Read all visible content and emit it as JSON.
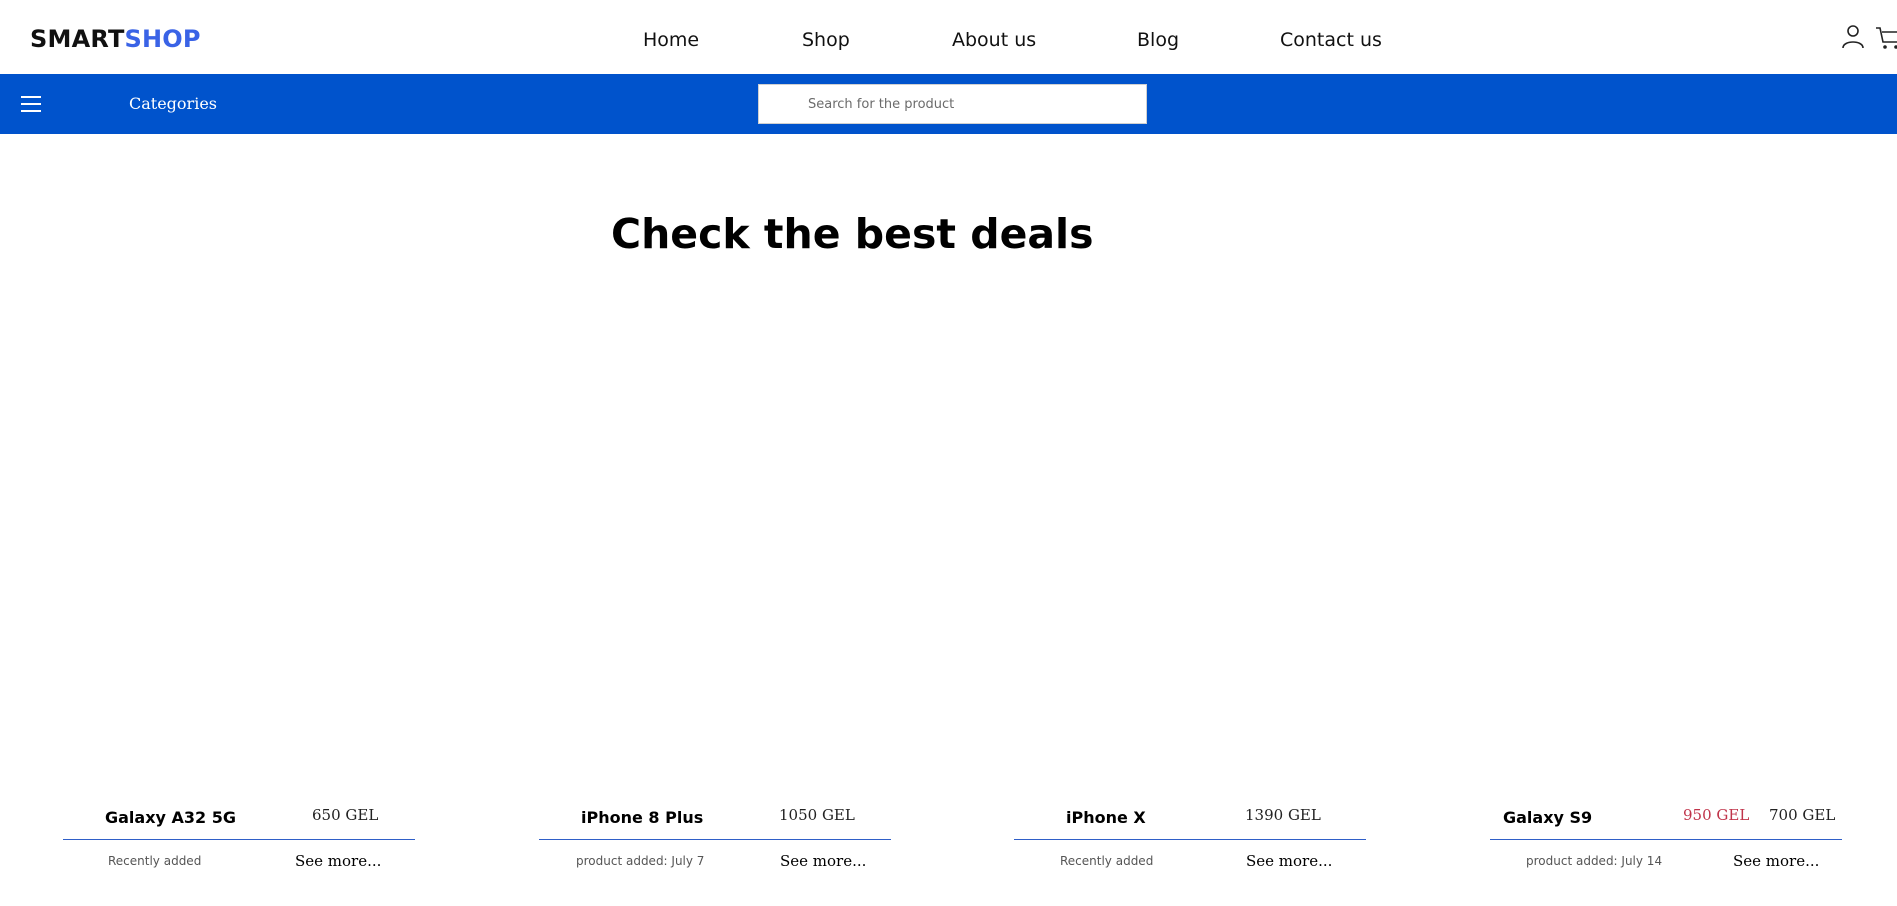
{
  "header": {
    "logo_part1": "SMART",
    "logo_part2": "SHOP",
    "nav": [
      "Home",
      "Shop",
      "About us",
      "Blog",
      "Contact us"
    ],
    "icons": [
      "user-icon",
      "cart-icon"
    ]
  },
  "bar": {
    "menu_icon": "hamburger-icon",
    "categories_label": "Categories",
    "search_placeholder": "Search for the product"
  },
  "main": {
    "headline": "Check the best deals"
  },
  "products": [
    {
      "name": "Galaxy A32 5G",
      "price": "650 GEL",
      "note": "Recently added",
      "more": "See more..."
    },
    {
      "name": "iPhone 8 Plus",
      "price": "1050 GEL",
      "note": "product added: July 7",
      "more": "See more..."
    },
    {
      "name": "iPhone X",
      "price": "1390 GEL",
      "note": "Recently added",
      "more": "See more..."
    },
    {
      "name": "Galaxy S9",
      "old_price": "950 GEL",
      "price": "700 GEL",
      "note": "product added: July 14",
      "more": "See more..."
    }
  ],
  "colors": {
    "brand_blue": "#3a63e6",
    "bar_blue": "#0053cc",
    "old_price_red": "#c0344a"
  }
}
